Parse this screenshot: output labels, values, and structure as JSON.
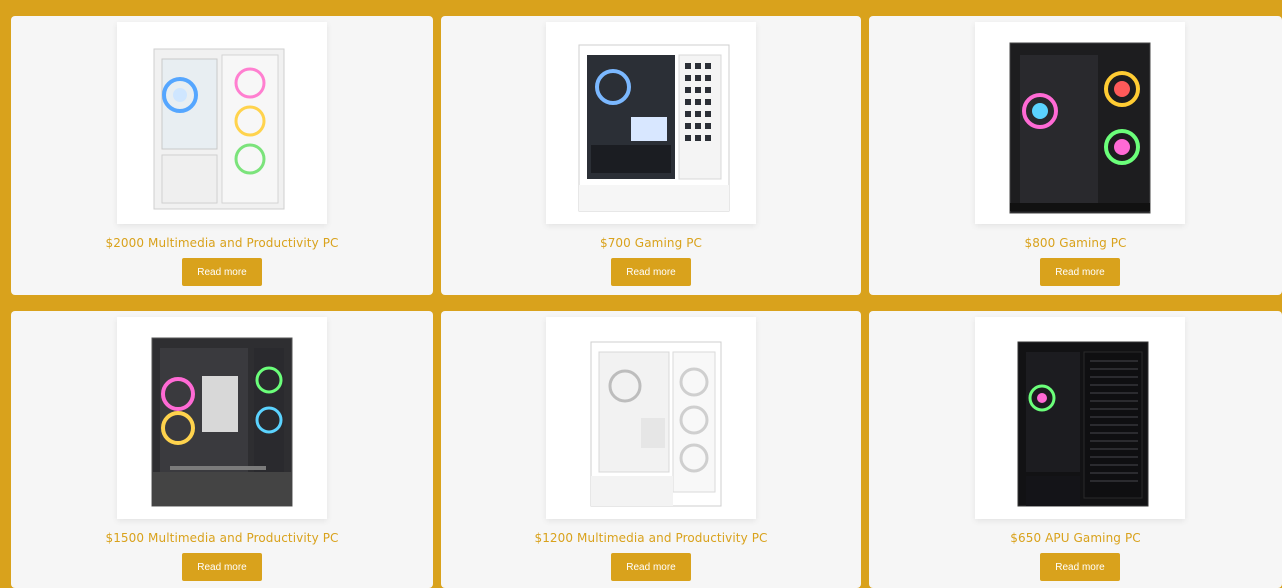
{
  "colors": {
    "accent": "#d9a21c",
    "card_bg": "#f6f6f6",
    "thumb_bg": "#ffffff"
  },
  "products": [
    {
      "title": "$2000 Multimedia and Productivity PC",
      "button_label": "Read more",
      "case_color": "white",
      "icon": "pc-case-white-mesh-image"
    },
    {
      "title": "$700 Gaming PC",
      "button_label": "Read more",
      "case_color": "white",
      "icon": "pc-case-white-window-image"
    },
    {
      "title": "$800 Gaming PC",
      "button_label": "Read more",
      "case_color": "black",
      "icon": "pc-case-black-glass-image"
    },
    {
      "title": "$1500 Multimedia and Productivity PC",
      "button_label": "Read more",
      "case_color": "dark-gray",
      "icon": "pc-case-dark-glass-image"
    },
    {
      "title": "$1200 Multimedia and Productivity PC",
      "button_label": "Read more",
      "case_color": "white",
      "icon": "pc-case-white-airflow-image"
    },
    {
      "title": "$650 APU Gaming PC",
      "button_label": "Read more",
      "case_color": "black",
      "icon": "pc-case-black-mesh-image"
    }
  ]
}
